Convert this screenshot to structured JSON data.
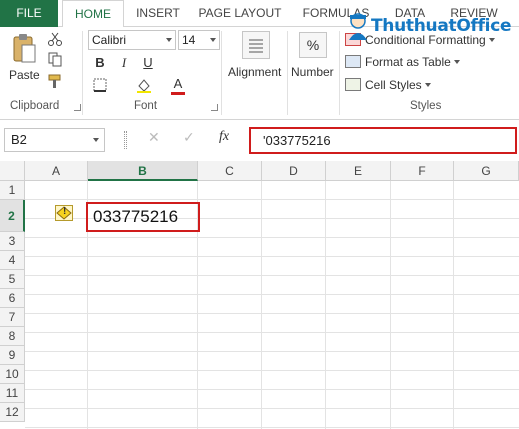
{
  "tabs": {
    "file": "FILE",
    "home": "HOME",
    "insert": "INSERT",
    "page_layout": "PAGE LAYOUT",
    "formulas": "FORMULAS",
    "data": "DATA",
    "review": "REVIEW"
  },
  "ribbon": {
    "clipboard": {
      "paste_label": "Paste",
      "group_label": "Clipboard"
    },
    "font": {
      "font_name": "Calibri",
      "font_size": "14",
      "bold": "B",
      "italic": "I",
      "underline": "U",
      "font_color_glyph": "A",
      "group_label": "Font"
    },
    "alignment_label": "Alignment",
    "number": {
      "label": "Number",
      "glyph": "%"
    },
    "styles": {
      "conditional_formatting": "Conditional Formatting",
      "format_as_table": "Format as Table",
      "cell_styles": "Cell Styles",
      "group_label": "Styles"
    }
  },
  "watermark": {
    "text": "ThuthuatOffice"
  },
  "formula_bar": {
    "name_box": "B2",
    "fx_label": "fx",
    "cancel_glyph": "✕",
    "enter_glyph": "✓",
    "content": "'033775216"
  },
  "sheet": {
    "columns": [
      "A",
      "B",
      "C",
      "D",
      "E",
      "F",
      "G"
    ],
    "rows": [
      "1",
      "2",
      "3",
      "4",
      "5",
      "6",
      "7",
      "8",
      "9",
      "10",
      "11",
      "12"
    ],
    "active_column": "B",
    "active_row": "2",
    "b2_value": "033775216",
    "warning_glyph": "!"
  },
  "colors": {
    "excel_green": "#217346",
    "highlight_red": "#d01c1c",
    "watermark_blue": "#1578c2"
  }
}
